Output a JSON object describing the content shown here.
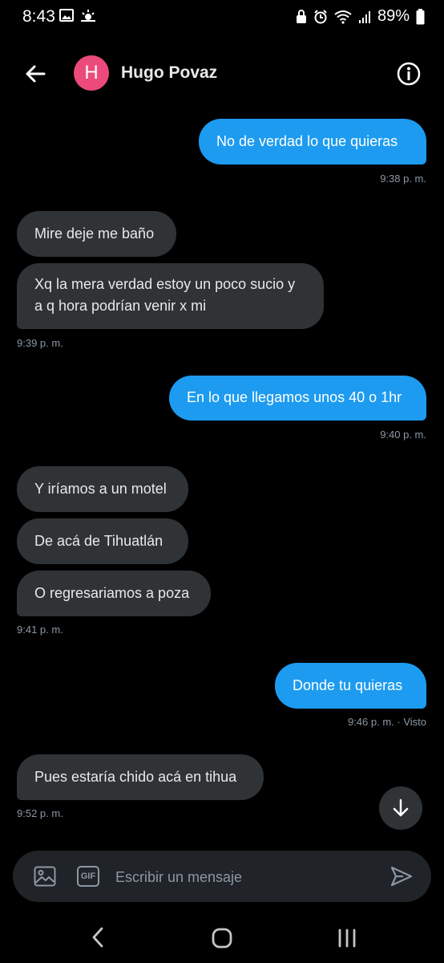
{
  "status": {
    "time": "8:43",
    "battery": "89%"
  },
  "header": {
    "avatar_letter": "H",
    "name": "Hugo Povaz"
  },
  "messages": [
    {
      "text": "No de verdad lo que  quieras"
    },
    {
      "text": "Mire deje me baño"
    },
    {
      "text": "Xq la mera verdad estoy un poco sucio y a q hora podrían venir x mi"
    },
    {
      "text": "En lo que llegamos unos 40 o 1hr"
    },
    {
      "text": "Y iríamos a un motel"
    },
    {
      "text": "De acá de Tihuatlán"
    },
    {
      "text": "O regresariamos a poza"
    },
    {
      "text": "Donde tu quieras"
    },
    {
      "text": "Pues estaría chido acá en tihua"
    }
  ],
  "timestamps": [
    {
      "text": "9:38 p. m."
    },
    {
      "text": "9:39 p. m."
    },
    {
      "text": "9:40 p. m."
    },
    {
      "text": "9:41 p. m."
    },
    {
      "text": "9:46 p. m. · Visto"
    },
    {
      "text": "9:52 p. m."
    }
  ],
  "composer": {
    "placeholder": "Escribir un mensaje",
    "gif_label": "GIF"
  },
  "colors": {
    "outgoing": "#1d9bf0",
    "incoming": "#2f3336",
    "avatar": "#ec4a7a",
    "background": "#000000"
  }
}
